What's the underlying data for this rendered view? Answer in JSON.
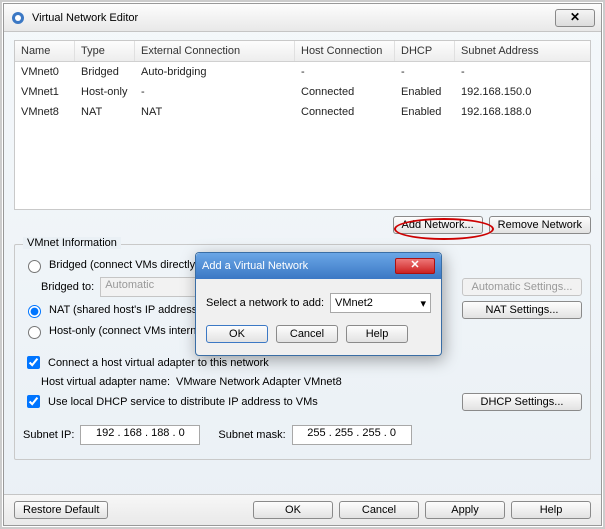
{
  "window": {
    "title": "Virtual Network Editor",
    "close_glyph": "✕"
  },
  "table": {
    "headers": {
      "name": "Name",
      "type": "Type",
      "ext": "External Connection",
      "host": "Host Connection",
      "dhcp": "DHCP",
      "subnet": "Subnet Address"
    },
    "rows": [
      {
        "name": "VMnet0",
        "type": "Bridged",
        "ext": "Auto-bridging",
        "host": "-",
        "dhcp": "-",
        "subnet": "-"
      },
      {
        "name": "VMnet1",
        "type": "Host-only",
        "ext": "-",
        "host": "Connected",
        "dhcp": "Enabled",
        "subnet": "192.168.150.0"
      },
      {
        "name": "VMnet8",
        "type": "NAT",
        "ext": "NAT",
        "host": "Connected",
        "dhcp": "Enabled",
        "subnet": "192.168.188.0"
      }
    ]
  },
  "buttons": {
    "add_network": "Add Network...",
    "remove_network": "Remove Network",
    "automatic_settings": "Automatic Settings...",
    "nat_settings": "NAT Settings...",
    "dhcp_settings": "DHCP Settings...",
    "restore_default": "Restore Default",
    "ok": "OK",
    "cancel": "Cancel",
    "apply": "Apply",
    "help": "Help"
  },
  "group": {
    "title": "VMnet Information",
    "bridged_label": "Bridged (connect VMs directly to the external network)",
    "bridged_to_label": "Bridged to:",
    "bridged_to_value": "Automatic",
    "nat_label": "NAT (shared host's IP address with VMs)",
    "hostonly_label": "Host-only (connect VMs internally in a private network)",
    "connect_adapter_label": "Connect a host virtual adapter to this network",
    "adapter_name_label": "Host virtual adapter name:",
    "adapter_name_value": "VMware Network Adapter VMnet8",
    "use_dhcp_label": "Use local DHCP service to distribute IP address to VMs",
    "subnet_ip_label": "Subnet IP:",
    "subnet_ip_value": "192 . 168 . 188 .  0",
    "subnet_mask_label": "Subnet mask:",
    "subnet_mask_value": "255 . 255 . 255 .  0"
  },
  "dialog": {
    "title": "Add a Virtual Network",
    "prompt": "Select a network to add:",
    "selected": "VMnet2",
    "ok": "OK",
    "cancel": "Cancel",
    "help": "Help",
    "close_glyph": "✕"
  }
}
